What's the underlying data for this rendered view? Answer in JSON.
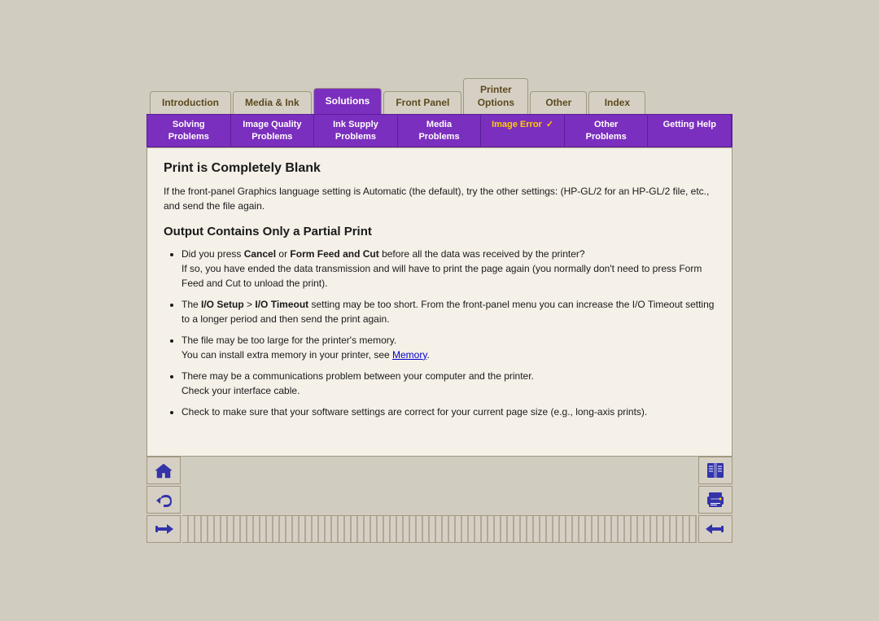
{
  "topTabs": [
    {
      "label": "Introduction",
      "active": false
    },
    {
      "label": "Media & Ink",
      "active": false
    },
    {
      "label": "Solutions",
      "active": true
    },
    {
      "label": "Front Panel",
      "active": false
    },
    {
      "label": "Printer Options",
      "active": false,
      "multiline": true
    },
    {
      "label": "Other",
      "active": false
    },
    {
      "label": "Index",
      "active": false
    }
  ],
  "subTabs": [
    {
      "label": "Solving Problems",
      "active": false
    },
    {
      "label": "Image Quality Problems",
      "active": false,
      "multiline": true
    },
    {
      "label": "Ink Supply Problems",
      "active": false,
      "multiline": true
    },
    {
      "label": "Media Problems",
      "active": false
    },
    {
      "label": "Image Error",
      "active": true,
      "hasCheck": true
    },
    {
      "label": "Other Problems",
      "active": false
    },
    {
      "label": "Getting Help",
      "active": false
    }
  ],
  "content": {
    "title": "Print is Completely Blank",
    "intro": "If the front-panel Graphics language setting is Automatic (the default), try the other settings: (HP-GL/2 for an HP-GL/2 file, etc., and send the file again.",
    "section2Title": "Output Contains Only a Partial Print",
    "bullets": [
      {
        "text": "Did you press Cancel or Form Feed and Cut before all the data was received by the printer?\nIf so, you have ended the data transmission and will have to print the page again (you normally don't need to press Form Feed and Cut to unload the print).",
        "boldParts": [
          "Cancel",
          "Form Feed and Cut"
        ]
      },
      {
        "text": "The I/O Setup > I/O Timeout setting may be too short. From the front-panel menu you can increase the I/O Timeout setting to a longer period and then send the print again.",
        "boldParts": [
          "I/O Setup",
          "I/O Timeout"
        ]
      },
      {
        "text": "The file may be too large for the printer's memory.\nYou can install extra memory in your printer, see Memory.",
        "hasLink": true,
        "linkText": "Memory"
      },
      {
        "text": "There may be a communications problem between your computer and the printer.\nCheck your interface cable."
      },
      {
        "text": "Check to make sure that your software settings are correct for your current page size (e.g., long-axis prints)."
      }
    ]
  },
  "buttons": {
    "home": "🏠",
    "back": "↩",
    "forward": "➡",
    "book": "📖",
    "print": "🖨",
    "next": "➡"
  }
}
